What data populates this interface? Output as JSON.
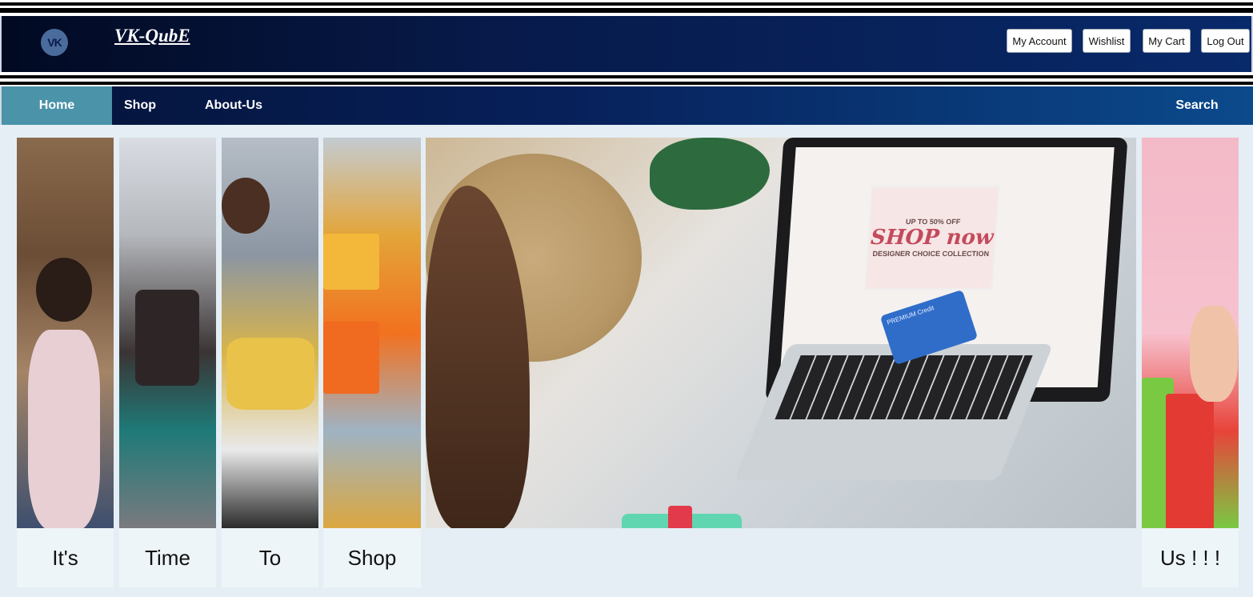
{
  "header": {
    "logo_icon": "vk-icon",
    "logo_glyph": "VK",
    "brand": "VK-QubE",
    "buttons": {
      "my_account": "My Account",
      "wishlist": "Wishlist",
      "my_cart": "My Cart",
      "log_out": "Log Out"
    }
  },
  "nav": {
    "home": "Home",
    "shop": "Shop",
    "about": "About-Us",
    "search": "Search"
  },
  "banner": {
    "captions": [
      "It's",
      "Time",
      "To",
      "Shop",
      "Us ! ! !"
    ],
    "promo": {
      "line1": "UP TO 50% OFF",
      "line2": "SHOP now",
      "line3": "DESIGNER CHOICE COLLECTION"
    },
    "card_text": "PREMIUM Credit"
  },
  "colors": {
    "header_bg": "#071a4a",
    "nav_active": "#4a93a8",
    "nav_bg": "#07205a"
  }
}
